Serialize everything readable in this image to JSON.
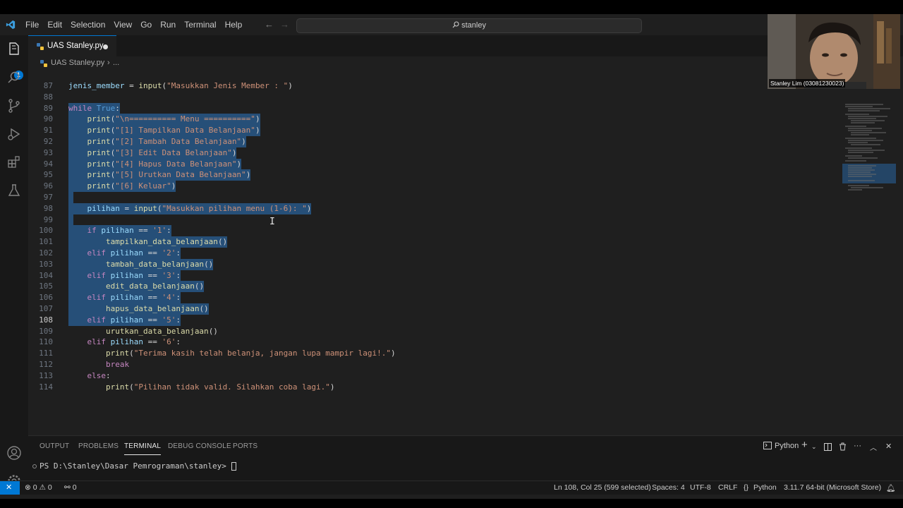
{
  "menu": [
    "File",
    "Edit",
    "Selection",
    "View",
    "Go",
    "Run",
    "Terminal",
    "Help"
  ],
  "search": {
    "text": "stanley"
  },
  "activity_badge": "1",
  "tab": {
    "label": "UAS Stanley.py"
  },
  "breadcrumb": {
    "file": "UAS Stanley.py",
    "more": "..."
  },
  "code_lines": [
    {
      "n": "87",
      "sel": false,
      "indent": "",
      "tokens": [
        [
          "var",
          "jenis_member"
        ],
        [
          "tx",
          " = "
        ],
        [
          "fn",
          "input"
        ],
        [
          "tx",
          "("
        ],
        [
          "str",
          "\"Masukkan Jenis Member : \""
        ],
        [
          "tx",
          ")"
        ]
      ]
    },
    {
      "n": "88",
      "sel": false,
      "indent": "",
      "tokens": []
    },
    {
      "n": "89",
      "sel": true,
      "indent": "",
      "tokens": [
        [
          "kw",
          "while"
        ],
        [
          "tx",
          " "
        ],
        [
          "kb",
          "True"
        ],
        [
          "tx",
          ":"
        ]
      ]
    },
    {
      "n": "90",
      "sel": true,
      "indent": "    ",
      "tokens": [
        [
          "fn",
          "print"
        ],
        [
          "tx",
          "("
        ],
        [
          "str",
          "\"\\n========== Menu ==========\""
        ],
        [
          "tx",
          ")"
        ]
      ]
    },
    {
      "n": "91",
      "sel": true,
      "indent": "    ",
      "tokens": [
        [
          "fn",
          "print"
        ],
        [
          "tx",
          "("
        ],
        [
          "str",
          "\"[1] Tampilkan Data Belanjaan\""
        ],
        [
          "tx",
          ")"
        ]
      ]
    },
    {
      "n": "92",
      "sel": true,
      "indent": "    ",
      "tokens": [
        [
          "fn",
          "print"
        ],
        [
          "tx",
          "("
        ],
        [
          "str",
          "\"[2] Tambah Data Belanjaan\""
        ],
        [
          "tx",
          ")"
        ]
      ]
    },
    {
      "n": "93",
      "sel": true,
      "indent": "    ",
      "tokens": [
        [
          "fn",
          "print"
        ],
        [
          "tx",
          "("
        ],
        [
          "str",
          "\"[3] Edit Data Belanjaan\""
        ],
        [
          "tx",
          ")"
        ]
      ]
    },
    {
      "n": "94",
      "sel": true,
      "indent": "    ",
      "tokens": [
        [
          "fn",
          "print"
        ],
        [
          "tx",
          "("
        ],
        [
          "str",
          "\"[4] Hapus Data Belanjaan\""
        ],
        [
          "tx",
          ")"
        ]
      ]
    },
    {
      "n": "95",
      "sel": true,
      "indent": "    ",
      "tokens": [
        [
          "fn",
          "print"
        ],
        [
          "tx",
          "("
        ],
        [
          "str",
          "\"[5] Urutkan Data Belanjaan\""
        ],
        [
          "tx",
          ")"
        ]
      ]
    },
    {
      "n": "96",
      "sel": true,
      "indent": "    ",
      "tokens": [
        [
          "fn",
          "print"
        ],
        [
          "tx",
          "("
        ],
        [
          "str",
          "\"[6] Keluar\""
        ],
        [
          "tx",
          ")"
        ]
      ]
    },
    {
      "n": "97",
      "sel": true,
      "indent": "",
      "tokens": []
    },
    {
      "n": "98",
      "sel": true,
      "indent": "    ",
      "tokens": [
        [
          "var",
          "pilihan"
        ],
        [
          "tx",
          " = "
        ],
        [
          "fn",
          "input"
        ],
        [
          "tx",
          "("
        ],
        [
          "str",
          "\"Masukkan pilihan menu (1-6): \""
        ],
        [
          "tx",
          ")"
        ]
      ]
    },
    {
      "n": "99",
      "sel": true,
      "indent": "",
      "tokens": []
    },
    {
      "n": "100",
      "sel": true,
      "indent": "    ",
      "tokens": [
        [
          "kw",
          "if"
        ],
        [
          "tx",
          " "
        ],
        [
          "var",
          "pilihan"
        ],
        [
          "tx",
          " == "
        ],
        [
          "str",
          "'1'"
        ],
        [
          "tx",
          ":"
        ]
      ]
    },
    {
      "n": "101",
      "sel": true,
      "indent": "        ",
      "tokens": [
        [
          "fn",
          "tampilkan_data_belanjaan"
        ],
        [
          "tx",
          "()"
        ]
      ]
    },
    {
      "n": "102",
      "sel": true,
      "indent": "    ",
      "tokens": [
        [
          "kw",
          "elif"
        ],
        [
          "tx",
          " "
        ],
        [
          "var",
          "pilihan"
        ],
        [
          "tx",
          " == "
        ],
        [
          "str",
          "'2'"
        ],
        [
          "tx",
          ":"
        ]
      ]
    },
    {
      "n": "103",
      "sel": true,
      "indent": "        ",
      "tokens": [
        [
          "fn",
          "tambah_data_belanjaan"
        ],
        [
          "tx",
          "()"
        ]
      ]
    },
    {
      "n": "104",
      "sel": true,
      "indent": "    ",
      "tokens": [
        [
          "kw",
          "elif"
        ],
        [
          "tx",
          " "
        ],
        [
          "var",
          "pilihan"
        ],
        [
          "tx",
          " == "
        ],
        [
          "str",
          "'3'"
        ],
        [
          "tx",
          ":"
        ]
      ]
    },
    {
      "n": "105",
      "sel": true,
      "indent": "        ",
      "tokens": [
        [
          "fn",
          "edit_data_belanjaan"
        ],
        [
          "tx",
          "()"
        ]
      ]
    },
    {
      "n": "106",
      "sel": true,
      "indent": "    ",
      "tokens": [
        [
          "kw",
          "elif"
        ],
        [
          "tx",
          " "
        ],
        [
          "var",
          "pilihan"
        ],
        [
          "tx",
          " == "
        ],
        [
          "str",
          "'4'"
        ],
        [
          "tx",
          ":"
        ]
      ]
    },
    {
      "n": "107",
      "sel": true,
      "indent": "        ",
      "tokens": [
        [
          "fn",
          "hapus_data_belanjaan"
        ],
        [
          "tx",
          "()"
        ]
      ]
    },
    {
      "n": "108",
      "sel": true,
      "active": true,
      "indent": "    ",
      "tokens": [
        [
          "kw",
          "elif"
        ],
        [
          "tx",
          " "
        ],
        [
          "var",
          "pilihan"
        ],
        [
          "tx",
          " == "
        ],
        [
          "str",
          "'5'"
        ],
        [
          "tx",
          ":"
        ]
      ]
    },
    {
      "n": "109",
      "sel": false,
      "indent": "        ",
      "tokens": [
        [
          "fn",
          "urutkan_data_belanjaan"
        ],
        [
          "tx",
          "()"
        ]
      ]
    },
    {
      "n": "110",
      "sel": false,
      "indent": "    ",
      "tokens": [
        [
          "kw",
          "elif"
        ],
        [
          "tx",
          " "
        ],
        [
          "var",
          "pilihan"
        ],
        [
          "tx",
          " == "
        ],
        [
          "str",
          "'6'"
        ],
        [
          "tx",
          ":"
        ]
      ]
    },
    {
      "n": "111",
      "sel": false,
      "indent": "        ",
      "tokens": [
        [
          "fn",
          "print"
        ],
        [
          "tx",
          "("
        ],
        [
          "str",
          "\"Terima kasih telah belanja, jangan lupa mampir lagi!.\""
        ],
        [
          "tx",
          ")"
        ]
      ]
    },
    {
      "n": "112",
      "sel": false,
      "indent": "        ",
      "tokens": [
        [
          "kw",
          "break"
        ]
      ]
    },
    {
      "n": "113",
      "sel": false,
      "indent": "    ",
      "tokens": [
        [
          "kw",
          "else"
        ],
        [
          "tx",
          ":"
        ]
      ]
    },
    {
      "n": "114",
      "sel": false,
      "indent": "        ",
      "tokens": [
        [
          "fn",
          "print"
        ],
        [
          "tx",
          "("
        ],
        [
          "str",
          "\"Pilihan tidak valid. Silahkan coba lagi.\""
        ],
        [
          "tx",
          ")"
        ]
      ]
    }
  ],
  "webcam": {
    "name": "Stanley Lim (03081230023)"
  },
  "panel": {
    "tabs": [
      "OUTPUT",
      "PROBLEMS",
      "TERMINAL",
      "DEBUG CONSOLE",
      "PORTS"
    ],
    "active_tab": "TERMINAL",
    "shell": "Python",
    "prompt": "PS D:\\Stanley\\Dasar Pemrograman\\stanley> "
  },
  "status": {
    "errors": "0",
    "warnings": "0",
    "ports": "0",
    "position": "Ln 108, Col 25 (599 selected)",
    "spaces": "Spaces: 4",
    "encoding": "UTF-8",
    "eol": "CRLF",
    "language": "Python",
    "interpreter": "3.11.7 64-bit (Microsoft Store)"
  },
  "colors": {
    "accent": "#0078d4",
    "editor_bg": "#1f1f1f",
    "selection": "#264f78",
    "keyword": "#c586c0",
    "function": "#dcdcaa",
    "string": "#ce9178",
    "variable": "#9cdcfe"
  }
}
